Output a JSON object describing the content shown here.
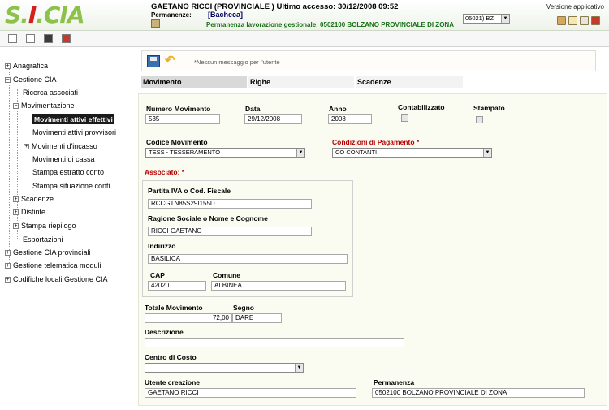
{
  "header": {
    "logo": "S.I.CIA",
    "user_line": "GAETANO RICCI (PROVINCIALE ) Ultimo accesso: 30/12/2008 09:52",
    "perm_label": "Permanenze:",
    "perm_value": "[Bacheca]",
    "perm_work": "Permanenza lavorazione gestionale: 0502100 BOLZANO PROVINCIALE DI ZONA",
    "province": "05021) BZ",
    "version": "Versione applicativo"
  },
  "sidebar": {
    "items": [
      {
        "label": "Anagrafica"
      },
      {
        "label": "Gestione CIA"
      },
      {
        "label": "Ricerca associati"
      },
      {
        "label": "Movimentazione"
      },
      {
        "label": "Movimenti attivi effettivi"
      },
      {
        "label": "Movimenti attivi provvisori"
      },
      {
        "label": "Movimenti d'incasso"
      },
      {
        "label": "Movimenti di cassa"
      },
      {
        "label": "Stampa estratto conto"
      },
      {
        "label": "Stampa situazione conti"
      },
      {
        "label": "Scadenze"
      },
      {
        "label": "Distinte"
      },
      {
        "label": "Stampa riepilogo"
      },
      {
        "label": "Esportazioni"
      },
      {
        "label": "Gestione CIA provinciali"
      },
      {
        "label": "Gestione telematica moduli"
      },
      {
        "label": "Codifiche locali Gestione CIA"
      }
    ]
  },
  "message": "*Nessun messaggio per l'utente",
  "tabs": [
    {
      "label": "Movimento"
    },
    {
      "label": "Righe"
    },
    {
      "label": "Scadenze"
    }
  ],
  "form": {
    "numero_label": "Numero Movimento",
    "numero_value": "535",
    "data_label": "Data",
    "data_value": "29/12/2008",
    "anno_label": "Anno",
    "anno_value": "2008",
    "contab_label": "Contabilizzato",
    "stampato_label": "Stampato",
    "codice_label": "Codice Movimento",
    "codice_value": "TESS - TESSERAMENTO",
    "condizioni_label": "Condizioni di Pagamento *",
    "condizioni_value": "CO CONTANTI",
    "associato_label": "Associato: *",
    "piva_label": "Partita IVA o Cod. Fiscale",
    "piva_value": "RCCGTN85S29I155D",
    "ragione_label": "Ragione Sociale o Nome e Cognome",
    "ragione_value": "RICCI GAETANO",
    "indirizzo_label": "Indirizzo",
    "indirizzo_value": "BASILICA",
    "cap_label": "CAP",
    "cap_value": "42020",
    "comune_label": "Comune",
    "comune_value": "ALBINEA",
    "totale_label": "Totale Movimento",
    "totale_value": "72,00",
    "segno_label": "Segno",
    "segno_value": "DARE",
    "descrizione_label": "Descrizione",
    "descrizione_value": "",
    "centro_label": "Centro di Costo",
    "centro_value": "",
    "utente_label": "Utente creazione",
    "utente_value": "GAETANO RICCI",
    "permanenza_label": "Permanenza",
    "permanenza_value": "0502100 BOLZANO PROVINCIALE DI ZONA"
  }
}
